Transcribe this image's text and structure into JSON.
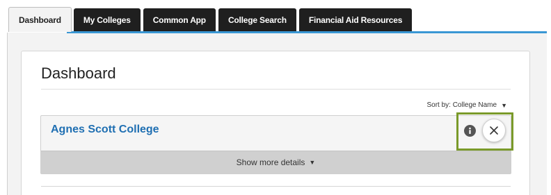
{
  "tabs": [
    {
      "label": "Dashboard",
      "active": true
    },
    {
      "label": "My Colleges"
    },
    {
      "label": "Common App"
    },
    {
      "label": "College Search"
    },
    {
      "label": "Financial Aid Resources"
    }
  ],
  "page": {
    "title": "Dashboard",
    "sort_label": "Sort by: College Name"
  },
  "colleges": [
    {
      "name": "Agnes Scott College",
      "details_label": "Show more details"
    }
  ],
  "icons": {
    "info": "info-icon",
    "close": "close-icon",
    "caret": "caret-down-icon"
  },
  "colors": {
    "accent": "#3a97d4",
    "link": "#1f6fb2",
    "highlight": "#7a9a2a",
    "tab_dark": "#1f1f1f"
  }
}
